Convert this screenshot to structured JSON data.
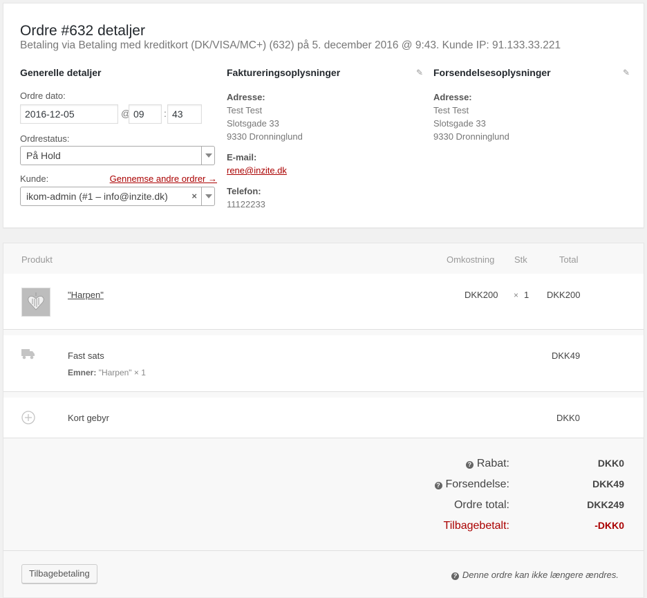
{
  "order": {
    "title": "Ordre #632 detaljer",
    "subtitle": "Betaling via Betaling med kreditkort (DK/VISA/MC+) (632) på 5. december 2016 @ 9:43. Kunde IP: 91.133.33.221"
  },
  "general": {
    "heading": "Generelle detaljer",
    "date_label": "Ordre dato:",
    "date_value": "2016-12-05",
    "at_sign": "@",
    "hour_value": "09",
    "colon": ":",
    "minute_value": "43",
    "status_label": "Ordrestatus:",
    "status_value": "På Hold",
    "customer_label": "Kunde:",
    "browse_link": "Gennemse andre ordrer →",
    "customer_value": "ikom-admin (#1 – info@inzite.dk)",
    "clear_symbol": "×"
  },
  "billing": {
    "heading": "Faktureringsoplysninger",
    "address_label": "Adresse:",
    "address_lines": [
      "Test Test",
      "Slotsgade 33",
      "9330 Dronninglund"
    ],
    "email_label": "E-mail:",
    "email": "rene@inzite.dk",
    "phone_label": "Telefon:",
    "phone": "11122233"
  },
  "shipping": {
    "heading": "Forsendelsesoplysninger",
    "address_label": "Adresse:",
    "address_lines": [
      "Test Test",
      "Slotsgade 33",
      "9330 Dronninglund"
    ]
  },
  "items": {
    "headers": {
      "product": "Produkt",
      "cost": "Omkostning",
      "qty": "Stk",
      "total": "Total"
    },
    "product": {
      "name": "\"Harpen\"",
      "cost": "DKK200",
      "qty_x": "×",
      "qty": "1",
      "total": "DKK200"
    },
    "shipping_line": {
      "name": "Fast sats",
      "items_label": "Emner:",
      "items_value": "\"Harpen\" × 1",
      "total": "DKK49"
    },
    "fee_line": {
      "name": "Kort gebyr",
      "total": "DKK0"
    }
  },
  "totals": {
    "discount_label": "Rabat:",
    "discount_value": "DKK0",
    "shipping_label": "Forsendelse:",
    "shipping_value": "DKK49",
    "order_total_label": "Ordre total:",
    "order_total_value": "DKK249",
    "refunded_label": "Tilbagebetalt:",
    "refunded_value": "-DKK0"
  },
  "footer": {
    "refund_button": "Tilbagebetaling",
    "note": "Denne ordre kan ikke længere ændres."
  },
  "colors": {
    "accent_red": "#a00000",
    "border": "#dfdfdf",
    "panel_bg": "#ffffff",
    "page_bg": "#f1f1f1"
  }
}
